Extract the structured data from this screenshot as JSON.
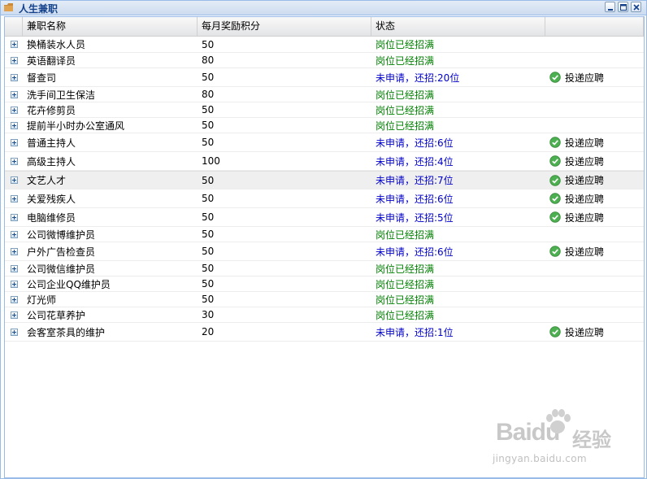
{
  "window": {
    "title": "人生兼职",
    "buttons": {
      "minimize": "minimize",
      "maximize": "maximize",
      "close": "close"
    }
  },
  "grid": {
    "columns": [
      "兼职名称",
      "每月奖励积分",
      "状态",
      ""
    ],
    "apply_label": "投递应聘",
    "rows": [
      {
        "name": "换桶装水人员",
        "points": "50",
        "status": "岗位已经招满",
        "status_type": "full",
        "apply": false
      },
      {
        "name": "英语翻译员",
        "points": "80",
        "status": "岗位已经招满",
        "status_type": "full",
        "apply": false
      },
      {
        "name": "督查司",
        "points": "50",
        "status": "未申请，还招:20位",
        "status_type": "open",
        "apply": true
      },
      {
        "name": "洗手间卫生保洁",
        "points": "80",
        "status": "岗位已经招满",
        "status_type": "full",
        "apply": false
      },
      {
        "name": "花卉修剪员",
        "points": "50",
        "status": "岗位已经招满",
        "status_type": "full",
        "apply": false
      },
      {
        "name": "提前半小时办公室通风",
        "points": "50",
        "status": "岗位已经招满",
        "status_type": "full",
        "apply": false
      },
      {
        "name": "普通主持人",
        "points": "50",
        "status": "未申请，还招:6位",
        "status_type": "open",
        "apply": true
      },
      {
        "name": "高级主持人",
        "points": "100",
        "status": "未申请，还招:4位",
        "status_type": "open",
        "apply": true
      },
      {
        "name": "文艺人才",
        "points": "50",
        "status": "未申请，还招:7位",
        "status_type": "open",
        "apply": true,
        "selected": true
      },
      {
        "name": "关爱残疾人",
        "points": "50",
        "status": "未申请，还招:6位",
        "status_type": "open",
        "apply": true
      },
      {
        "name": "电脑维修员",
        "points": "50",
        "status": "未申请，还招:5位",
        "status_type": "open",
        "apply": true
      },
      {
        "name": "公司微博维护员",
        "points": "50",
        "status": "岗位已经招满",
        "status_type": "full",
        "apply": false
      },
      {
        "name": "户外广告检查员",
        "points": "50",
        "status": "未申请，还招:6位",
        "status_type": "open",
        "apply": true
      },
      {
        "name": "公司微信维护员",
        "points": "50",
        "status": "岗位已经招满",
        "status_type": "full",
        "apply": false
      },
      {
        "name": "公司企业QQ维护员",
        "points": "50",
        "status": "岗位已经招满",
        "status_type": "full",
        "apply": false
      },
      {
        "name": "灯光师",
        "points": "50",
        "status": "岗位已经招满",
        "status_type": "full",
        "apply": false
      },
      {
        "name": "公司花草养护",
        "points": "30",
        "status": "岗位已经招满",
        "status_type": "full",
        "apply": false
      },
      {
        "name": "会客室茶具的维护",
        "points": "20",
        "status": "未申请，还招:1位",
        "status_type": "open",
        "apply": true
      }
    ]
  },
  "watermark": {
    "logo": "Baidu",
    "cn": "经验",
    "url": "jingyan.baidu.com"
  },
  "colors": {
    "full": "#008000",
    "open": "#0000cc",
    "check": "#4caf50"
  }
}
